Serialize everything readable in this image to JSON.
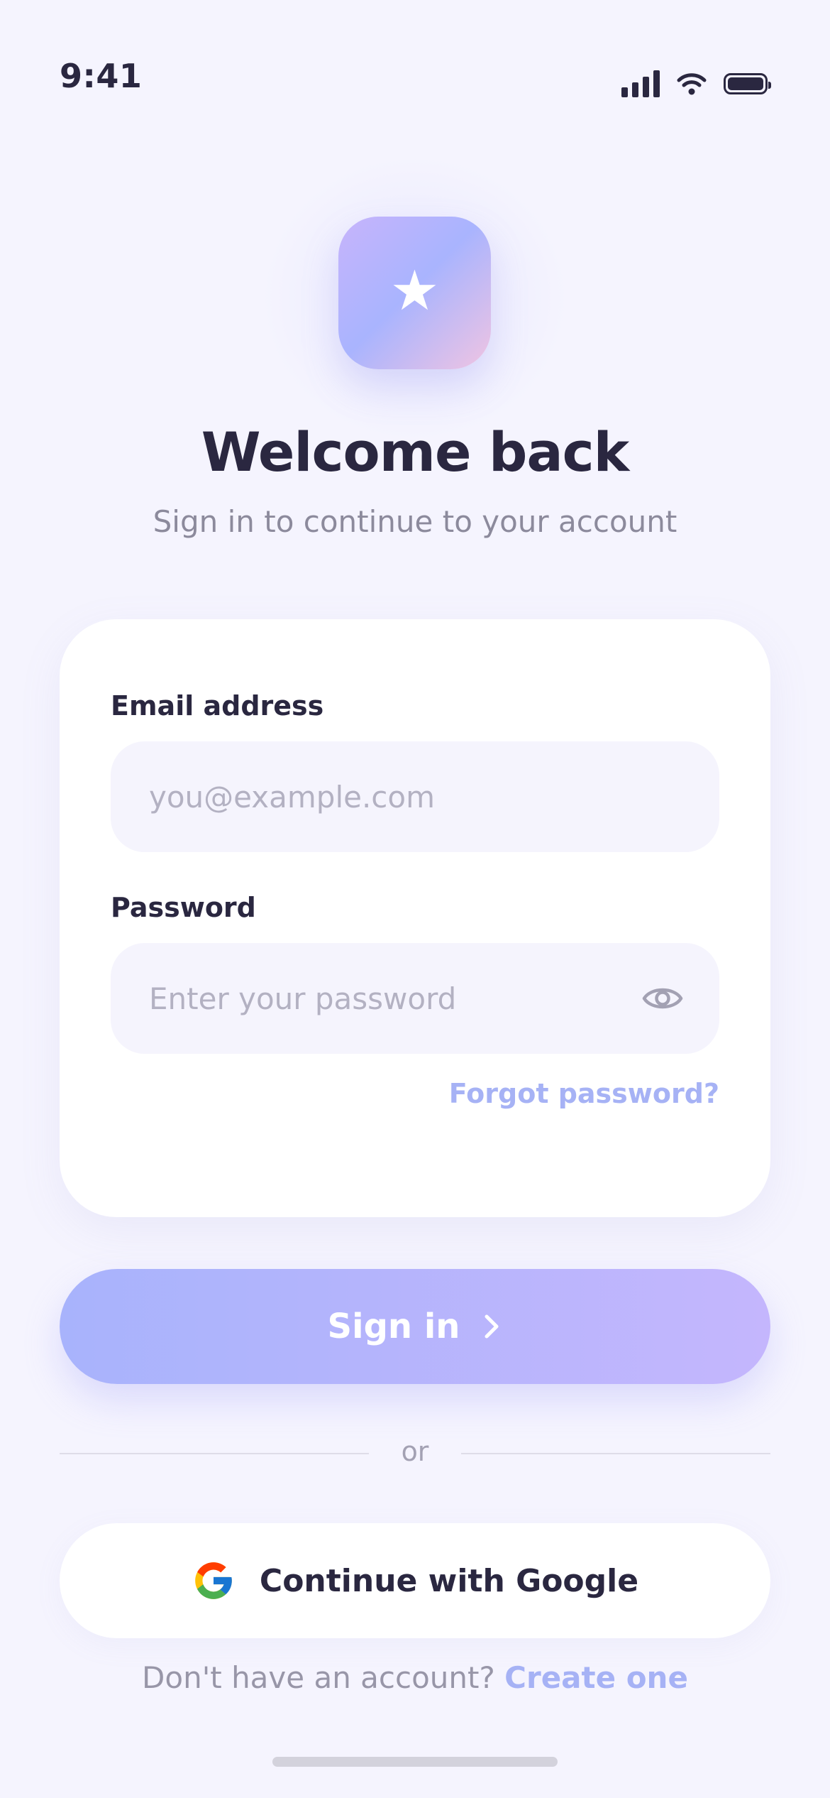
{
  "status_bar": {
    "time": "9:41",
    "icons": [
      "cellular-signal-icon",
      "wifi-icon",
      "battery-icon"
    ]
  },
  "logo": {
    "icon": "star-icon",
    "glyph": "★",
    "gradient": [
      "#c7b4fc",
      "#a9b4fe",
      "#f0c4e2"
    ]
  },
  "header": {
    "title": "Welcome back",
    "subtitle": "Sign in to continue to your account"
  },
  "form": {
    "email": {
      "label": "Email address",
      "placeholder": "you@example.com",
      "value": ""
    },
    "password": {
      "label": "Password",
      "placeholder": "Enter your password",
      "value": "",
      "toggle_icon": "eye-icon"
    },
    "forgot_label": "Forgot password?"
  },
  "sign_in_button": {
    "label": "Sign in",
    "icon": "chevron-right-icon"
  },
  "divider": {
    "label": "or"
  },
  "google_button": {
    "label": "Continue with Google",
    "icon": "google-icon"
  },
  "footer": {
    "prompt": "Don't have an account?",
    "link": "Create one"
  },
  "colors": {
    "background": "#f5f4fe",
    "text_primary": "#2a2740",
    "text_secondary": "#8c8a9c",
    "accent": "#a6b2f5",
    "button_gradient_start": "#a8b3fc",
    "button_gradient_end": "#c4b6fd",
    "field_background": "#f5f4fd"
  }
}
